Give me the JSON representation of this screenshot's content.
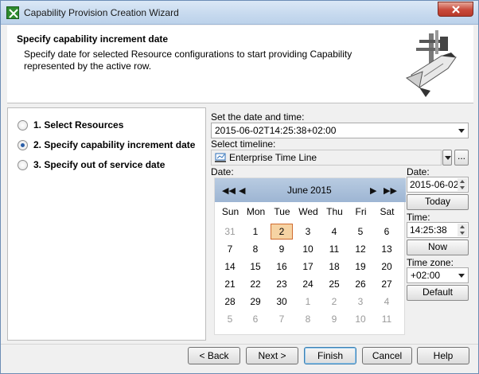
{
  "window": {
    "title": "Capability Provision Creation Wizard"
  },
  "header": {
    "title": "Specify capability increment date",
    "description": "Specify date for selected Resource configurations to start providing Capability represented by the active row."
  },
  "steps": [
    {
      "label": "1. Select Resources",
      "selected": false
    },
    {
      "label": "2. Specify capability increment date",
      "selected": true
    },
    {
      "label": "3. Specify out of service date",
      "selected": false
    }
  ],
  "form": {
    "datetime_label": "Set the date and time:",
    "datetime_value": "2015-06-02T14:25:38+02:00",
    "timeline_label": "Select timeline:",
    "timeline_value": "Enterprise Time Line",
    "ellipsis_label": "...",
    "date_label": "Date:"
  },
  "calendar": {
    "month": "June",
    "year": "2015",
    "nav_prev_year": "◀◀",
    "nav_prev_month": "◀",
    "nav_next_month": "▶",
    "nav_next_year": "▶▶",
    "weekdays": [
      "Sun",
      "Mon",
      "Tue",
      "Wed",
      "Thu",
      "Fri",
      "Sat"
    ],
    "weeks": [
      [
        "31",
        "1",
        "2",
        "3",
        "4",
        "5",
        "6"
      ],
      [
        "7",
        "8",
        "9",
        "10",
        "11",
        "12",
        "13"
      ],
      [
        "14",
        "15",
        "16",
        "17",
        "18",
        "19",
        "20"
      ],
      [
        "21",
        "22",
        "23",
        "24",
        "25",
        "26",
        "27"
      ],
      [
        "28",
        "29",
        "30",
        "1",
        "2",
        "3",
        "4"
      ],
      [
        "5",
        "6",
        "7",
        "8",
        "9",
        "10",
        "11"
      ]
    ],
    "selected_day": "2"
  },
  "side": {
    "date_label": "Date:",
    "date_value": "2015-06-02",
    "today_label": "Today",
    "time_label": "Time:",
    "time_value": "14:25:38",
    "now_label": "Now",
    "timezone_label": "Time zone:",
    "timezone_value": "+02:00",
    "default_label": "Default"
  },
  "footer": {
    "back_label": "< Back",
    "next_label": "Next >",
    "finish_label": "Finish",
    "cancel_label": "Cancel",
    "help_label": "Help"
  }
}
